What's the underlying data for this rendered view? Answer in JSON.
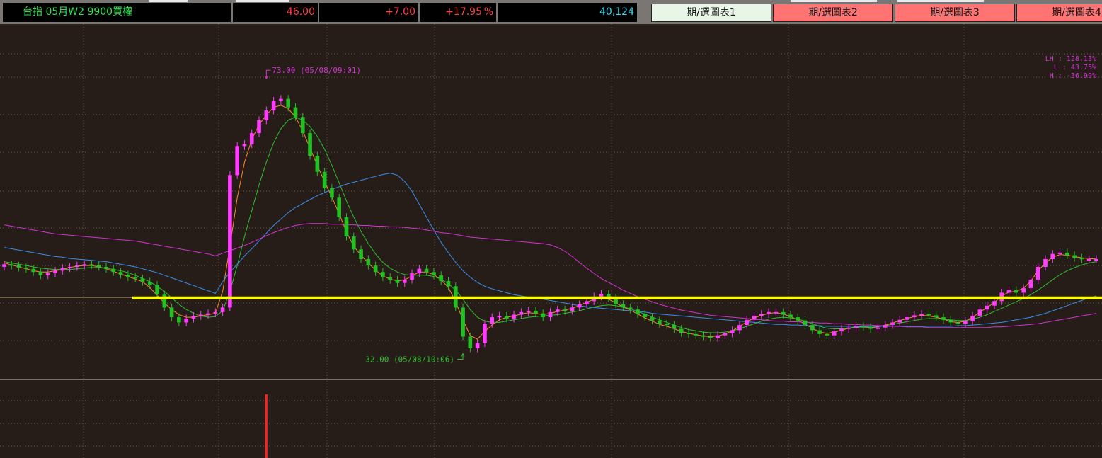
{
  "header": {
    "instrument_label": "台指 05月W2 9900買權",
    "price": "46.00",
    "change": "+7.00",
    "change_pct": "+17.95",
    "pct_unit": "%",
    "volume": "40,124"
  },
  "chart_buttons": [
    {
      "label": "期/選圖表1",
      "active": true
    },
    {
      "label": "期/選圖表2",
      "active": false
    },
    {
      "label": "期/選圖表3",
      "active": false
    },
    {
      "label": "期/選圖表4",
      "active": false
    }
  ],
  "stats": {
    "lh": "LH : 128.13%",
    "l": "L  :  43.75%",
    "h": "H  : -36.99%"
  },
  "annotations": {
    "high_marker": "73.00 (05/08/09:01)",
    "low_marker": "32.00 (05/08/10:06)"
  },
  "colors": {
    "background": "#261c18",
    "up_candle": "#ff3cff",
    "down_candle": "#22c022",
    "ma_short": "#ff8a2a",
    "ma_mid": "#2fbf2f",
    "ma_long": "#3a8eea",
    "ma_longest": "#d233d2",
    "support_line": "#ffff00"
  },
  "chart_data": {
    "type": "line",
    "x_range": [
      0,
      150
    ],
    "y_range": [
      30,
      78
    ],
    "high": {
      "x": 36,
      "value": 73.0
    },
    "low": {
      "x": 63,
      "value": 32.0
    },
    "support_level": 40.0,
    "close": [
      45.2,
      45.0,
      44.7,
      44.5,
      44.0,
      43.5,
      43.8,
      44.2,
      44.6,
      44.8,
      45.0,
      45.2,
      45.1,
      44.8,
      44.5,
      44.0,
      43.6,
      43.2,
      43.0,
      42.5,
      42.0,
      40.5,
      38.5,
      37.0,
      36.2,
      36.8,
      37.2,
      37.4,
      37.6,
      37.8,
      38.5,
      59.0,
      63.5,
      63.8,
      65.5,
      67.5,
      69.0,
      70.5,
      70.8,
      69.5,
      68.0,
      65.5,
      62.0,
      59.5,
      57.0,
      55.5,
      52.5,
      49.5,
      47.5,
      46.0,
      45.0,
      44.0,
      43.2,
      42.8,
      42.3,
      42.8,
      43.8,
      44.5,
      44.0,
      43.5,
      42.6,
      41.8,
      38.5,
      34.0,
      32.2,
      33.0,
      36.0,
      37.0,
      37.2,
      36.8,
      37.4,
      37.8,
      38.0,
      37.6,
      37.0,
      37.8,
      38.2,
      38.0,
      38.5,
      39.0,
      39.5,
      40.2,
      40.6,
      40.0,
      39.0,
      38.5,
      38.2,
      37.5,
      37.0,
      36.5,
      36.0,
      35.8,
      35.2,
      34.6,
      34.4,
      34.2,
      34.0,
      33.8,
      34.2,
      34.5,
      35.0,
      35.8,
      36.6,
      37.2,
      37.5,
      37.8,
      37.8,
      37.4,
      37.0,
      36.5,
      35.8,
      35.0,
      34.4,
      34.2,
      34.8,
      35.2,
      35.4,
      35.6,
      35.5,
      35.2,
      35.4,
      35.8,
      36.2,
      36.6,
      37.0,
      37.3,
      37.5,
      37.3,
      37.0,
      36.6,
      36.2,
      36.0,
      36.4,
      37.2,
      38.2,
      38.8,
      39.5,
      40.8,
      41.2,
      40.8,
      41.5,
      42.8,
      44.8,
      46.0,
      46.8,
      47.0,
      46.6,
      46.2,
      46.0,
      46.0,
      46.0
    ],
    "series": [
      {
        "key": "ma_short",
        "values": [
          45.4,
          45.1,
          44.8,
          44.5,
          44.2,
          44.0,
          44.0,
          44.2,
          44.4,
          44.7,
          44.9,
          45.0,
          45.0,
          44.8,
          44.5,
          44.1,
          43.7,
          43.3,
          42.9,
          42.5,
          41.6,
          40.4,
          39.2,
          38.2,
          37.4,
          37.0,
          37.0,
          37.2,
          37.4,
          37.6,
          41.0,
          48.0,
          55.5,
          61.0,
          64.5,
          66.8,
          68.3,
          69.5,
          69.8,
          69.3,
          68.0,
          65.8,
          63.2,
          60.5,
          58.0,
          55.6,
          53.0,
          50.2,
          48.0,
          46.6,
          45.4,
          44.3,
          43.4,
          42.9,
          42.6,
          42.8,
          43.4,
          44.0,
          44.0,
          43.6,
          42.8,
          41.6,
          39.4,
          36.6,
          34.2,
          33.6,
          34.8,
          35.8,
          36.6,
          37.0,
          37.2,
          37.5,
          37.7,
          37.6,
          37.4,
          37.6,
          37.9,
          38.1,
          38.4,
          38.8,
          39.3,
          39.8,
          40.1,
          39.8,
          39.2,
          38.6,
          38.1,
          37.5,
          36.9,
          36.4,
          35.9,
          35.6,
          35.2,
          34.8,
          34.5,
          34.3,
          34.1,
          34.0,
          34.1,
          34.4,
          34.9,
          35.6,
          36.3,
          36.9,
          37.3,
          37.6,
          37.7,
          37.5,
          37.1,
          36.6,
          35.9,
          35.3,
          34.7,
          34.5,
          34.7,
          35.0,
          35.3,
          35.5,
          35.5,
          35.4,
          35.5,
          35.8,
          36.1,
          36.5,
          36.8,
          37.1,
          37.3,
          37.2,
          37.0,
          36.7,
          36.3,
          36.2,
          36.4,
          37.0,
          37.8,
          38.5,
          39.3,
          40.3,
          40.9,
          41.0,
          41.5,
          42.6,
          44.2,
          45.4,
          46.3,
          46.7,
          46.6,
          46.4,
          46.2,
          46.1,
          46.0
        ]
      },
      {
        "key": "ma_mid",
        "values": [
          45.6,
          45.4,
          45.2,
          45.0,
          44.8,
          44.6,
          44.5,
          44.4,
          44.4,
          44.4,
          44.5,
          44.6,
          44.7,
          44.7,
          44.6,
          44.4,
          44.2,
          43.9,
          43.5,
          43.0,
          42.5,
          41.8,
          41.0,
          40.0,
          39.0,
          38.2,
          37.6,
          37.2,
          37.0,
          37.1,
          38.0,
          41.0,
          45.0,
          49.5,
          53.5,
          57.5,
          61.0,
          64.0,
          66.2,
          67.5,
          68.0,
          67.5,
          66.5,
          65.0,
          63.0,
          60.5,
          57.8,
          55.0,
          52.5,
          50.3,
          48.4,
          46.8,
          45.5,
          44.6,
          44.0,
          43.6,
          43.5,
          43.5,
          43.5,
          43.3,
          42.9,
          42.2,
          41.2,
          39.8,
          38.2,
          37.0,
          36.4,
          36.2,
          36.2,
          36.4,
          36.6,
          36.8,
          37.0,
          37.1,
          37.2,
          37.3,
          37.4,
          37.6,
          37.8,
          38.0,
          38.3,
          38.6,
          38.8,
          38.9,
          38.8,
          38.6,
          38.3,
          37.9,
          37.5,
          37.0,
          36.6,
          36.2,
          35.8,
          35.4,
          35.1,
          34.9,
          34.7,
          34.6,
          34.6,
          34.7,
          34.9,
          35.2,
          35.6,
          36.0,
          36.4,
          36.7,
          36.9,
          37.0,
          36.9,
          36.7,
          36.4,
          36.0,
          35.6,
          35.3,
          35.2,
          35.2,
          35.3,
          35.4,
          35.5,
          35.6,
          35.6,
          35.7,
          35.9,
          36.1,
          36.3,
          36.5,
          36.7,
          36.8,
          36.8,
          36.7,
          36.6,
          36.5,
          36.5,
          36.7,
          37.0,
          37.4,
          37.9,
          38.4,
          38.9,
          39.4,
          39.9,
          40.5,
          41.2,
          42.0,
          42.8,
          43.6,
          44.2,
          44.7,
          45.1,
          45.4,
          45.6
        ]
      },
      {
        "key": "ma_long",
        "values": [
          47.8,
          47.6,
          47.4,
          47.2,
          47.0,
          46.8,
          46.6,
          46.4,
          46.3,
          46.1,
          46.0,
          45.9,
          45.8,
          45.7,
          45.6,
          45.4,
          45.2,
          45.0,
          44.8,
          44.5,
          44.2,
          43.9,
          43.5,
          43.1,
          42.7,
          42.3,
          41.9,
          41.5,
          41.1,
          40.7,
          42.5,
          44.0,
          45.2,
          46.5,
          47.6,
          48.8,
          50.0,
          51.2,
          52.2,
          53.2,
          54.0,
          54.6,
          55.2,
          55.8,
          56.3,
          56.8,
          57.2,
          57.6,
          57.9,
          58.2,
          58.5,
          58.8,
          59.1,
          59.3,
          59.0,
          58.0,
          56.5,
          54.5,
          52.5,
          50.5,
          48.6,
          47.0,
          45.5,
          44.2,
          43.2,
          42.4,
          41.8,
          41.4,
          41.1,
          40.8,
          40.5,
          40.3,
          40.1,
          39.9,
          39.8,
          39.6,
          39.4,
          39.2,
          39.0,
          38.8,
          38.6,
          38.5,
          38.4,
          38.3,
          38.2,
          38.1,
          38.0,
          37.9,
          37.8,
          37.6,
          37.5,
          37.4,
          37.3,
          37.2,
          37.1,
          37.0,
          36.9,
          36.8,
          36.7,
          36.6,
          36.5,
          36.4,
          36.3,
          36.2,
          36.1,
          36.0,
          35.9,
          35.9,
          35.8,
          35.8,
          35.7,
          35.7,
          35.7,
          35.6,
          35.6,
          35.6,
          35.6,
          35.6,
          35.6,
          35.6,
          35.6,
          35.6,
          35.6,
          35.6,
          35.6,
          35.6,
          35.6,
          35.6,
          35.6,
          35.6,
          35.6,
          35.7,
          35.7,
          35.8,
          35.9,
          36.0,
          36.1,
          36.2,
          36.4,
          36.6,
          36.8,
          37.0,
          37.3,
          37.6,
          38.0,
          38.4,
          38.8,
          39.2,
          39.6,
          40.0,
          40.3
        ]
      },
      {
        "key": "ma_longest",
        "values": [
          51.3,
          51.1,
          50.9,
          50.7,
          50.5,
          50.3,
          50.1,
          49.9,
          49.8,
          49.7,
          49.6,
          49.5,
          49.4,
          49.3,
          49.2,
          49.1,
          49.0,
          48.9,
          48.8,
          48.6,
          48.4,
          48.2,
          48.0,
          47.8,
          47.6,
          47.4,
          47.2,
          47.0,
          46.8,
          46.5,
          46.9,
          47.3,
          47.7,
          48.1,
          48.6,
          49.1,
          49.6,
          50.1,
          50.5,
          50.9,
          51.2,
          51.4,
          51.5,
          51.5,
          51.5,
          51.4,
          51.4,
          51.3,
          51.3,
          51.2,
          51.2,
          51.1,
          51.1,
          51.0,
          51.0,
          50.9,
          50.8,
          50.7,
          50.5,
          50.3,
          50.1,
          50.0,
          49.8,
          49.6,
          49.4,
          49.3,
          49.2,
          49.1,
          49.0,
          48.9,
          48.8,
          48.7,
          48.6,
          48.5,
          48.4,
          48.2,
          47.8,
          47.2,
          46.4,
          45.5,
          44.6,
          43.8,
          43.0,
          42.4,
          41.8,
          41.2,
          40.7,
          40.2,
          39.8,
          39.4,
          39.0,
          38.7,
          38.4,
          38.1,
          37.9,
          37.7,
          37.5,
          37.3,
          37.2,
          37.1,
          37.0,
          36.9,
          36.8,
          36.7,
          36.6,
          36.5,
          36.4,
          36.4,
          36.3,
          36.3,
          36.2,
          36.2,
          36.1,
          36.1,
          36.0,
          36.0,
          35.9,
          35.9,
          35.8,
          35.8,
          35.7,
          35.7,
          35.6,
          35.6,
          35.5,
          35.5,
          35.5,
          35.4,
          35.4,
          35.4,
          35.4,
          35.4,
          35.4,
          35.4,
          35.4,
          35.4,
          35.5,
          35.5,
          35.6,
          35.7,
          35.8,
          35.9,
          36.0,
          36.2,
          36.4,
          36.6,
          36.8,
          37.0,
          37.2,
          37.4,
          37.6
        ]
      }
    ],
    "volume_spike": {
      "x": 36
    }
  }
}
